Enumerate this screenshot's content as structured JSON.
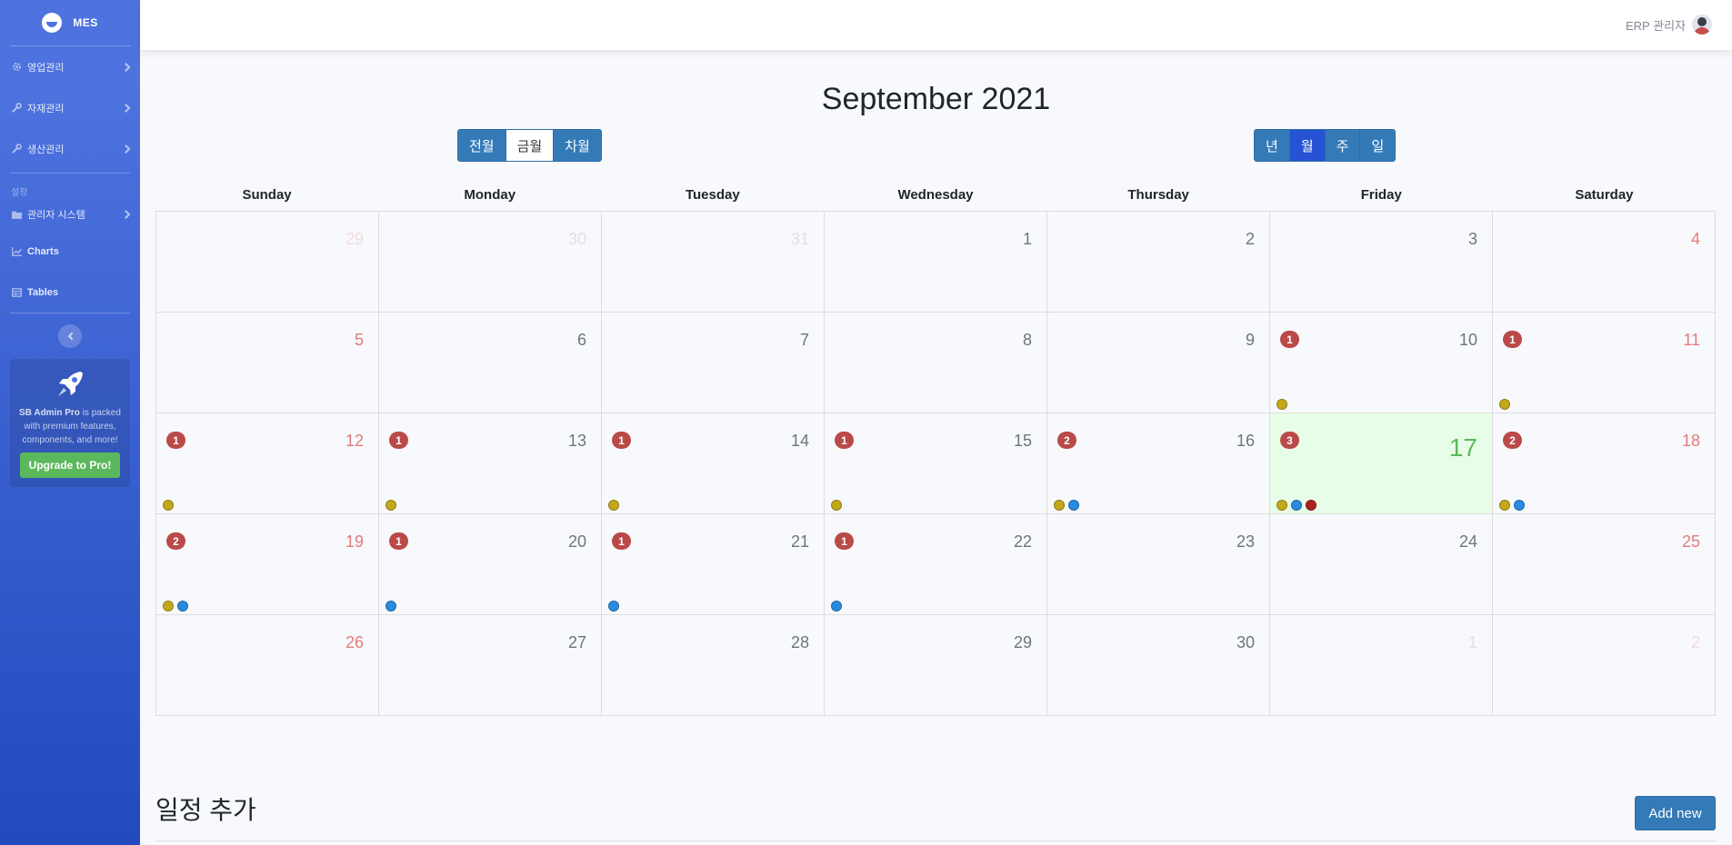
{
  "brand": {
    "name": "MES"
  },
  "sidebar": {
    "items": [
      {
        "label": "영업관리",
        "icon": "gear-icon"
      },
      {
        "label": "자재관리",
        "icon": "wrench-icon"
      },
      {
        "label": "생산관리",
        "icon": "wrench-icon"
      }
    ],
    "heading": "설정",
    "settings_items": [
      {
        "label": "관리자 시스템",
        "icon": "folder-icon"
      },
      {
        "label": "Charts",
        "icon": "chart-icon"
      },
      {
        "label": "Tables",
        "icon": "table-icon"
      }
    ],
    "promo": {
      "brand": "SB Admin Pro",
      "text": "is packed with premium features, components, and more!",
      "button": "Upgrade to Pro!"
    }
  },
  "topbar": {
    "user_name": "ERP 관리자"
  },
  "calendar": {
    "title": "September 2021",
    "nav_buttons": [
      "전월",
      "금월",
      "차월"
    ],
    "view_buttons": [
      "년",
      "월",
      "주",
      "일"
    ],
    "active_view": "월",
    "weekdays": [
      "Sunday",
      "Monday",
      "Tuesday",
      "Wednesday",
      "Thursday",
      "Friday",
      "Saturday"
    ],
    "colors": {
      "warning": "#c3a91a",
      "info": "#2a8ae0",
      "important": "#ad2121",
      "badge": "#b94a48",
      "today_bg": "#e8fde7"
    },
    "weeks": [
      [
        {
          "d": "29",
          "o": true
        },
        {
          "d": "30",
          "o": true
        },
        {
          "d": "31",
          "o": true
        },
        {
          "d": "1"
        },
        {
          "d": "2"
        },
        {
          "d": "3"
        },
        {
          "d": "4"
        }
      ],
      [
        {
          "d": "5"
        },
        {
          "d": "6"
        },
        {
          "d": "7"
        },
        {
          "d": "8"
        },
        {
          "d": "9"
        },
        {
          "d": "10",
          "c": "1",
          "e": [
            "warning"
          ]
        },
        {
          "d": "11",
          "c": "1",
          "e": [
            "warning"
          ]
        }
      ],
      [
        {
          "d": "12",
          "c": "1",
          "e": [
            "warning"
          ]
        },
        {
          "d": "13",
          "c": "1",
          "e": [
            "warning"
          ]
        },
        {
          "d": "14",
          "c": "1",
          "e": [
            "warning"
          ]
        },
        {
          "d": "15",
          "c": "1",
          "e": [
            "warning"
          ]
        },
        {
          "d": "16",
          "c": "2",
          "e": [
            "warning",
            "info"
          ]
        },
        {
          "d": "17",
          "c": "3",
          "e": [
            "warning",
            "info",
            "important"
          ],
          "t": true
        },
        {
          "d": "18",
          "c": "2",
          "e": [
            "warning",
            "info"
          ]
        }
      ],
      [
        {
          "d": "19",
          "c": "2",
          "e": [
            "warning",
            "info"
          ]
        },
        {
          "d": "20",
          "c": "1",
          "e": [
            "info"
          ]
        },
        {
          "d": "21",
          "c": "1",
          "e": [
            "info"
          ]
        },
        {
          "d": "22",
          "c": "1",
          "e": [
            "info"
          ]
        },
        {
          "d": "23"
        },
        {
          "d": "24"
        },
        {
          "d": "25"
        }
      ],
      [
        {
          "d": "26"
        },
        {
          "d": "27"
        },
        {
          "d": "28"
        },
        {
          "d": "29"
        },
        {
          "d": "30"
        },
        {
          "d": "1",
          "o": true
        },
        {
          "d": "2",
          "o": true
        }
      ]
    ]
  },
  "schedule": {
    "title": "일정 추가",
    "add_button": "Add new"
  }
}
